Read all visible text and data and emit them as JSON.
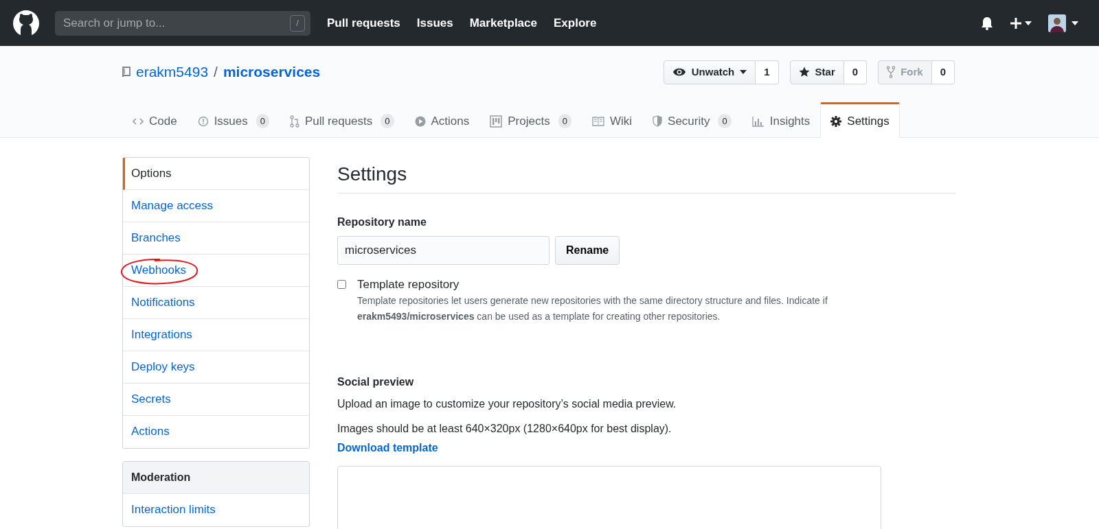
{
  "topbar": {
    "search_placeholder": "Search or jump to...",
    "slash_key": "/",
    "links": [
      "Pull requests",
      "Issues",
      "Marketplace",
      "Explore"
    ]
  },
  "repo": {
    "owner": "erakm5493",
    "separator": "/",
    "name": "microservices"
  },
  "actions": [
    {
      "kind": "watch",
      "label": "Unwatch",
      "count": "1",
      "disabled": false
    },
    {
      "kind": "star",
      "label": "Star",
      "count": "0",
      "disabled": false
    },
    {
      "kind": "fork",
      "label": "Fork",
      "count": "0",
      "disabled": true
    }
  ],
  "tabs": [
    {
      "kind": "code",
      "label": "Code",
      "selected": false
    },
    {
      "kind": "issues",
      "label": "Issues",
      "counter": "0",
      "selected": false
    },
    {
      "kind": "pulls",
      "label": "Pull requests",
      "counter": "0",
      "selected": false
    },
    {
      "kind": "actions",
      "label": "Actions",
      "selected": false
    },
    {
      "kind": "projects",
      "label": "Projects",
      "counter": "0",
      "selected": false
    },
    {
      "kind": "wiki",
      "label": "Wiki",
      "selected": false
    },
    {
      "kind": "security",
      "label": "Security",
      "counter": "0",
      "selected": false
    },
    {
      "kind": "insights",
      "label": "Insights",
      "selected": false
    },
    {
      "kind": "settings",
      "label": "Settings",
      "selected": true
    }
  ],
  "sidebar": {
    "items": [
      {
        "label": "Options",
        "selected": true,
        "circled": false
      },
      {
        "label": "Manage access",
        "selected": false,
        "circled": false
      },
      {
        "label": "Branches",
        "selected": false,
        "circled": false
      },
      {
        "label": "Webhooks",
        "selected": false,
        "circled": true
      },
      {
        "label": "Notifications",
        "selected": false,
        "circled": false
      },
      {
        "label": "Integrations",
        "selected": false,
        "circled": false
      },
      {
        "label": "Deploy keys",
        "selected": false,
        "circled": false
      },
      {
        "label": "Secrets",
        "selected": false,
        "circled": false
      },
      {
        "label": "Actions",
        "selected": false,
        "circled": false
      }
    ],
    "moderation": {
      "title": "Moderation",
      "items": [
        "Interaction limits"
      ]
    }
  },
  "settings": {
    "title": "Settings",
    "repo_name_label": "Repository name",
    "repo_name_value": "microservices",
    "rename_button": "Rename",
    "template": {
      "label": "Template repository",
      "checked": false,
      "description": "Template repositories let users generate new repositories with the same directory structure and files. Indicate if **erakm5493/microservices** can be used as a template for creating other repositories."
    },
    "social": {
      "title": "Social preview",
      "lines": [
        "Upload an image to customize your repository’s social media preview.",
        "Images should be at least 640×320px (1280×640px for best display)."
      ],
      "link": "Download template"
    }
  }
}
